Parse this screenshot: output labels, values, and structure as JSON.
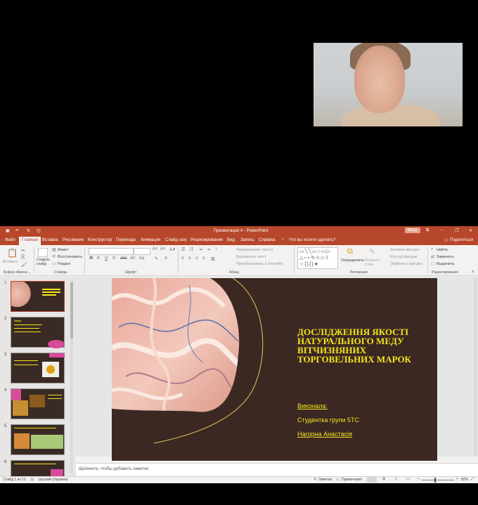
{
  "window": {
    "title": "Презентация 4  -  PowerPoint",
    "login_label": "Вход",
    "share_label": "Поделиться"
  },
  "tabs": [
    "Файл",
    "Главная",
    "Вставка",
    "Рисование",
    "Конструктор",
    "Переходы",
    "Анимация",
    "Слайд шоу",
    "Рецензирование",
    "Вид",
    "Запись",
    "Справка"
  ],
  "search": {
    "placeholder": "Что вы хотите сделать?"
  },
  "ribbon": {
    "paste": "Вставить",
    "create_slide": "Создать слайд",
    "layout": "Макет",
    "reset": "Восстановить",
    "section": "Раздел",
    "text_direction": "Направление текста",
    "align_text": "Выровнять текст",
    "smartart": "Преобразовать в SmartArt",
    "arrange": "Упорядочить",
    "quick_styles": "Экспресс-стили",
    "shape_fill": "Заливка фигуры",
    "shape_outline": "Контур фигуры",
    "shape_effects": "Эффекты фигуры",
    "find": "Найти",
    "replace": "Заменить",
    "select": "Выделить",
    "groups": {
      "clipboard": "Буфер обмена",
      "slides": "Слайды",
      "font": "Шрифт",
      "paragraph": "Абзац",
      "drawing": "Рисование",
      "editing": "Редактирование"
    }
  },
  "thumbnails": {
    "numbers": [
      "1",
      "2",
      "3",
      "4",
      "5",
      "6"
    ],
    "slide2_title": "Зміст"
  },
  "slide": {
    "title": "ДОСЛІДЖЕННЯ ЯКОСТІ НАТУРАЛЬНОГО МЕДУ ВІТЧИЗНЯНИХ ТОРГОВЕЛЬНИХ МАРОК",
    "performed_by": "Виконала:",
    "student": "Студентка групи 5ТС",
    "name": "Нагорна Анастасія"
  },
  "notes": {
    "placeholder": "Щелкните, чтобы добавить заметки"
  },
  "status": {
    "slide_of": "Слайд 1 из 13",
    "language": "русский (Украина)",
    "notes": "Заметки",
    "comments": "Примечания",
    "zoom": "82%"
  },
  "colors": {
    "accent": "#b7472a",
    "slide_bg": "#3b2823",
    "slide_text": "#f2e51c"
  }
}
